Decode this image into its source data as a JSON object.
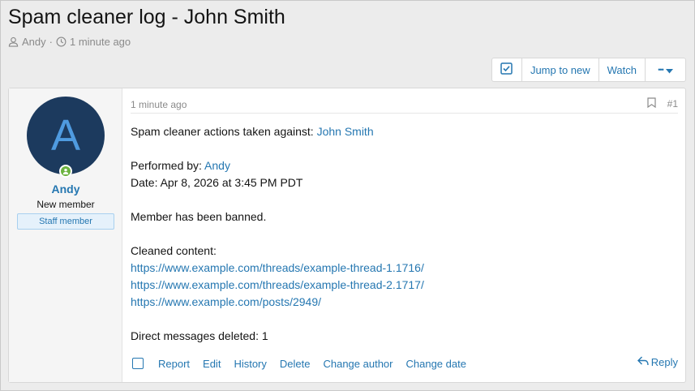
{
  "thread": {
    "title": "Spam cleaner log - John Smith",
    "author": "Andy",
    "separator": "·",
    "time": "1 minute ago"
  },
  "toolbar": {
    "jump_label": "Jump to new",
    "watch_label": "Watch",
    "more_label": "•••"
  },
  "user": {
    "avatar_letter": "A",
    "name": "Andy",
    "title": "New member",
    "badge": "Staff member"
  },
  "post": {
    "time": "1 minute ago",
    "number": "#1",
    "line1_prefix": "Spam cleaner actions taken against: ",
    "line1_link": "John Smith",
    "performed_prefix": "Performed by: ",
    "performed_link": "Andy",
    "date": "Date: Apr 8, 2026 at 3:45 PM PDT",
    "banned": "Member has been banned.",
    "cleaned_label": "Cleaned content:",
    "links": [
      "https://www.example.com/threads/example-thread-1.1716/",
      "https://www.example.com/threads/example-thread-2.1717/",
      "https://www.example.com/posts/2949/"
    ],
    "dm_deleted": "Direct messages deleted: 1"
  },
  "actions": {
    "report": "Report",
    "edit": "Edit",
    "history": "History",
    "delete": "Delete",
    "change_author": "Change author",
    "change_date": "Change date",
    "reply": "Reply"
  },
  "colors": {
    "link": "#2577b1",
    "avatar_bg": "#1c3a5e",
    "online": "#6cb33f"
  }
}
